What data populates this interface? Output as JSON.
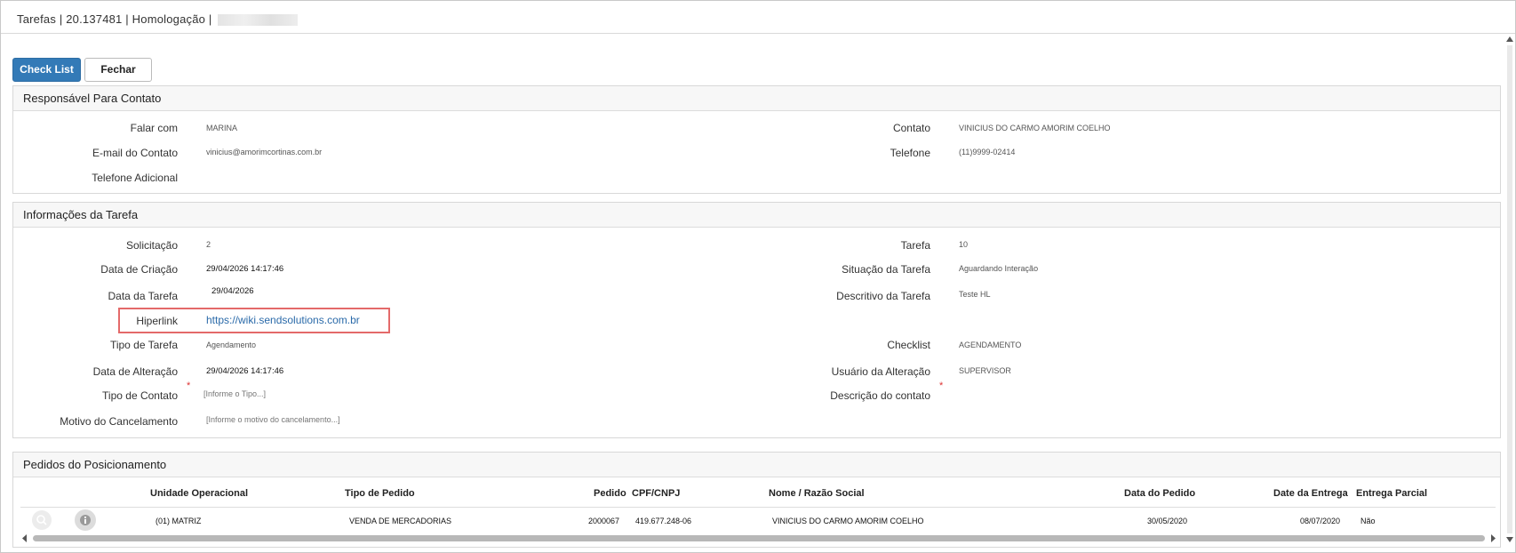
{
  "window": {
    "title": "Tarefas | 20.137481 | Homologação |"
  },
  "toolbar": {
    "checklist_label": "Check List",
    "close_label": "Fechar"
  },
  "contato": {
    "title": "Responsável Para Contato",
    "falar_com_label": "Falar com",
    "falar_com_value": "MARINA",
    "email_label": "E-mail do Contato",
    "email_value": "vinicius@amorimcortinas.com.br",
    "telefone_adicional_label": "Telefone Adicional",
    "contato_label": "Contato",
    "contato_value": "VINICIUS DO CARMO AMORIM COELHO",
    "telefone_label": "Telefone",
    "telefone_value": "(11)9999-02414"
  },
  "tarefa": {
    "title": "Informações da Tarefa",
    "solicitacao_label": "Solicitação",
    "solicitacao_value": "2",
    "data_criacao_label": "Data de Criação",
    "data_criacao_value": "29/04/2026 14:17:46",
    "data_tarefa_label": "Data da Tarefa",
    "data_tarefa_value": "29/04/2026",
    "hiperlink_label": "Hiperlink",
    "hiperlink_value": "https://wiki.sendsolutions.com.br",
    "tipo_tarefa_label": "Tipo de Tarefa",
    "tipo_tarefa_value": "Agendamento",
    "data_alteracao_label": "Data de Alteração",
    "data_alteracao_value": "29/04/2026 14:17:46",
    "tipo_contato_label": "Tipo de Contato",
    "tipo_contato_placeholder": "[Informe o Tipo...]",
    "motivo_label": "Motivo do Cancelamento",
    "motivo_placeholder": "[Informe o motivo do cancelamento...]",
    "tarefa_label": "Tarefa",
    "tarefa_value": "10",
    "situacao_label": "Situação da Tarefa",
    "situacao_value": "Aguardando Interação",
    "descritivo_label": "Descritivo da Tarefa",
    "descritivo_value": "Teste HL",
    "checklist_label": "Checklist",
    "checklist_value": "AGENDAMENTO",
    "usuario_label": "Usuário da Alteração",
    "usuario_value": "SUPERVISOR",
    "descricao_contato_label": "Descrição do contato",
    "required_mark": "*"
  },
  "pedidos": {
    "title": "Pedidos do Posicionamento",
    "columns": {
      "unidade": "Unidade Operacional",
      "tipo": "Tipo de Pedido",
      "pedido": "Pedido",
      "cpf": "CPF/CNPJ",
      "nome": "Nome / Razão Social",
      "data_pedido": "Data do Pedido",
      "data_entrega": "Date da Entrega",
      "parcial": "Entrega Parcial"
    },
    "rows": [
      {
        "unidade": "(01) MATRIZ",
        "tipo": "VENDA DE MERCADORIAS",
        "pedido": "2000067",
        "cpf": "419.677.248-06",
        "nome": "VINICIUS DO CARMO AMORIM COELHO",
        "data_pedido": "30/05/2020",
        "data_entrega": "08/07/2020",
        "parcial": "Não"
      }
    ]
  }
}
